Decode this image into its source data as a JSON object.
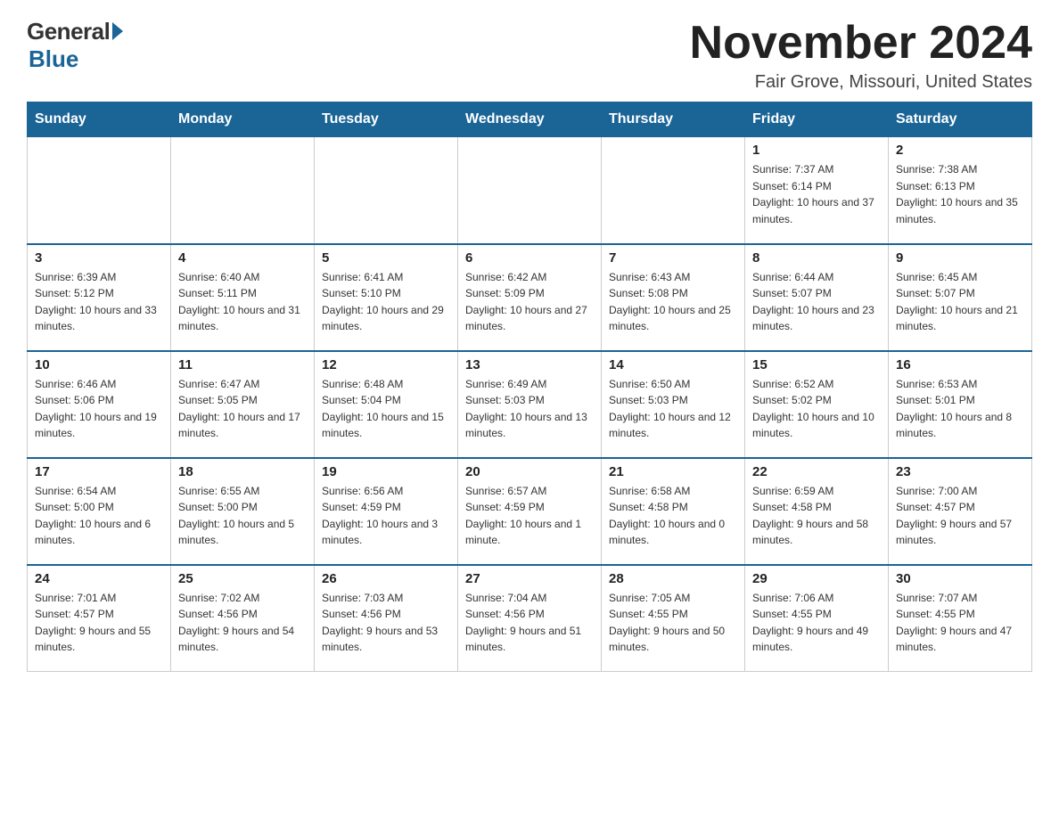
{
  "header": {
    "logo_general": "General",
    "logo_blue": "Blue",
    "month_title": "November 2024",
    "location": "Fair Grove, Missouri, United States"
  },
  "weekdays": [
    "Sunday",
    "Monday",
    "Tuesday",
    "Wednesday",
    "Thursday",
    "Friday",
    "Saturday"
  ],
  "weeks": [
    [
      {
        "day": "",
        "info": ""
      },
      {
        "day": "",
        "info": ""
      },
      {
        "day": "",
        "info": ""
      },
      {
        "day": "",
        "info": ""
      },
      {
        "day": "",
        "info": ""
      },
      {
        "day": "1",
        "info": "Sunrise: 7:37 AM\nSunset: 6:14 PM\nDaylight: 10 hours and 37 minutes."
      },
      {
        "day": "2",
        "info": "Sunrise: 7:38 AM\nSunset: 6:13 PM\nDaylight: 10 hours and 35 minutes."
      }
    ],
    [
      {
        "day": "3",
        "info": "Sunrise: 6:39 AM\nSunset: 5:12 PM\nDaylight: 10 hours and 33 minutes."
      },
      {
        "day": "4",
        "info": "Sunrise: 6:40 AM\nSunset: 5:11 PM\nDaylight: 10 hours and 31 minutes."
      },
      {
        "day": "5",
        "info": "Sunrise: 6:41 AM\nSunset: 5:10 PM\nDaylight: 10 hours and 29 minutes."
      },
      {
        "day": "6",
        "info": "Sunrise: 6:42 AM\nSunset: 5:09 PM\nDaylight: 10 hours and 27 minutes."
      },
      {
        "day": "7",
        "info": "Sunrise: 6:43 AM\nSunset: 5:08 PM\nDaylight: 10 hours and 25 minutes."
      },
      {
        "day": "8",
        "info": "Sunrise: 6:44 AM\nSunset: 5:07 PM\nDaylight: 10 hours and 23 minutes."
      },
      {
        "day": "9",
        "info": "Sunrise: 6:45 AM\nSunset: 5:07 PM\nDaylight: 10 hours and 21 minutes."
      }
    ],
    [
      {
        "day": "10",
        "info": "Sunrise: 6:46 AM\nSunset: 5:06 PM\nDaylight: 10 hours and 19 minutes."
      },
      {
        "day": "11",
        "info": "Sunrise: 6:47 AM\nSunset: 5:05 PM\nDaylight: 10 hours and 17 minutes."
      },
      {
        "day": "12",
        "info": "Sunrise: 6:48 AM\nSunset: 5:04 PM\nDaylight: 10 hours and 15 minutes."
      },
      {
        "day": "13",
        "info": "Sunrise: 6:49 AM\nSunset: 5:03 PM\nDaylight: 10 hours and 13 minutes."
      },
      {
        "day": "14",
        "info": "Sunrise: 6:50 AM\nSunset: 5:03 PM\nDaylight: 10 hours and 12 minutes."
      },
      {
        "day": "15",
        "info": "Sunrise: 6:52 AM\nSunset: 5:02 PM\nDaylight: 10 hours and 10 minutes."
      },
      {
        "day": "16",
        "info": "Sunrise: 6:53 AM\nSunset: 5:01 PM\nDaylight: 10 hours and 8 minutes."
      }
    ],
    [
      {
        "day": "17",
        "info": "Sunrise: 6:54 AM\nSunset: 5:00 PM\nDaylight: 10 hours and 6 minutes."
      },
      {
        "day": "18",
        "info": "Sunrise: 6:55 AM\nSunset: 5:00 PM\nDaylight: 10 hours and 5 minutes."
      },
      {
        "day": "19",
        "info": "Sunrise: 6:56 AM\nSunset: 4:59 PM\nDaylight: 10 hours and 3 minutes."
      },
      {
        "day": "20",
        "info": "Sunrise: 6:57 AM\nSunset: 4:59 PM\nDaylight: 10 hours and 1 minute."
      },
      {
        "day": "21",
        "info": "Sunrise: 6:58 AM\nSunset: 4:58 PM\nDaylight: 10 hours and 0 minutes."
      },
      {
        "day": "22",
        "info": "Sunrise: 6:59 AM\nSunset: 4:58 PM\nDaylight: 9 hours and 58 minutes."
      },
      {
        "day": "23",
        "info": "Sunrise: 7:00 AM\nSunset: 4:57 PM\nDaylight: 9 hours and 57 minutes."
      }
    ],
    [
      {
        "day": "24",
        "info": "Sunrise: 7:01 AM\nSunset: 4:57 PM\nDaylight: 9 hours and 55 minutes."
      },
      {
        "day": "25",
        "info": "Sunrise: 7:02 AM\nSunset: 4:56 PM\nDaylight: 9 hours and 54 minutes."
      },
      {
        "day": "26",
        "info": "Sunrise: 7:03 AM\nSunset: 4:56 PM\nDaylight: 9 hours and 53 minutes."
      },
      {
        "day": "27",
        "info": "Sunrise: 7:04 AM\nSunset: 4:56 PM\nDaylight: 9 hours and 51 minutes."
      },
      {
        "day": "28",
        "info": "Sunrise: 7:05 AM\nSunset: 4:55 PM\nDaylight: 9 hours and 50 minutes."
      },
      {
        "day": "29",
        "info": "Sunrise: 7:06 AM\nSunset: 4:55 PM\nDaylight: 9 hours and 49 minutes."
      },
      {
        "day": "30",
        "info": "Sunrise: 7:07 AM\nSunset: 4:55 PM\nDaylight: 9 hours and 47 minutes."
      }
    ]
  ]
}
